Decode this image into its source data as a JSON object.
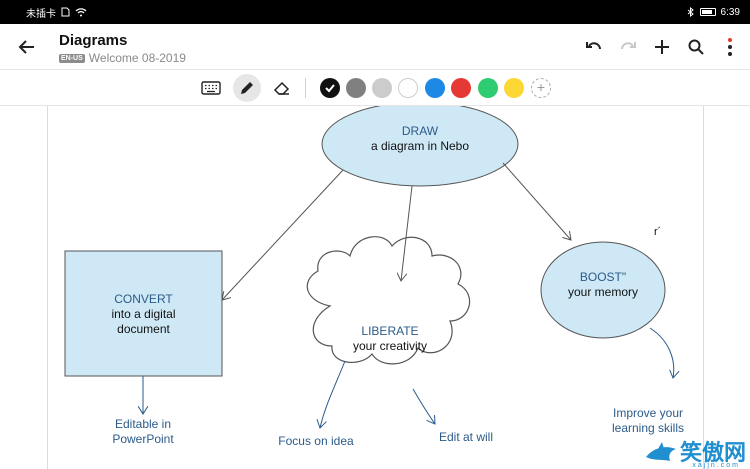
{
  "status_bar": {
    "carrier": "未插卡",
    "time": "6:39"
  },
  "app_bar": {
    "title": "Diagrams",
    "language_badge": "EN-US",
    "document_name": "Welcome 08-2019"
  },
  "toolbar": {
    "colors": [
      "#111111",
      "#808080",
      "#cccccc",
      "#ffffff",
      "#1e88e5",
      "#e53935",
      "#2ecc71",
      "#fdd835"
    ],
    "selected_color": "#111111"
  },
  "diagram": {
    "draw": {
      "keyword": "DRAW",
      "text": "a diagram in Nebo"
    },
    "convert": {
      "keyword": "CONVERT",
      "line1": "into a digital",
      "line2": "document"
    },
    "liberate": {
      "keyword": "LIBERATE",
      "text": "your creativity"
    },
    "boost": {
      "keyword": "BOOST\"",
      "text": "your memory"
    },
    "convert_result": {
      "line1": "Editable in",
      "line2": "PowerPoint"
    },
    "focus": "Focus on idea",
    "edit": "Edit at will",
    "improve": {
      "line1": "Improve your",
      "line2": "learning skills"
    },
    "stray_mark": "r´"
  },
  "watermark": {
    "text": "笑傲网",
    "sub": "xajjn.com"
  }
}
